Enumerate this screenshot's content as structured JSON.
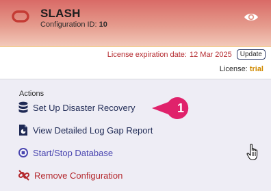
{
  "header": {
    "title": "SLASH",
    "config_label": "Configuration ID:",
    "config_id": "10",
    "brand_color": "#c43b34"
  },
  "license": {
    "expiration_label": "License expiration date:",
    "expiration_date": "12 Mar 2025",
    "update_button": "Update",
    "license_label": "License:",
    "license_value": "trial"
  },
  "actions": {
    "heading": "Actions",
    "items": [
      {
        "label": "Set Up Disaster Recovery",
        "icon": "database-icon"
      },
      {
        "label": "View Detailed Log Gap Report",
        "icon": "report-icon"
      },
      {
        "label": "Start/Stop Database",
        "icon": "stop-circle-icon"
      },
      {
        "label": "Remove Configuration",
        "icon": "broken-link-icon"
      }
    ]
  },
  "callout": {
    "number": "1",
    "color": "#e0226b"
  }
}
